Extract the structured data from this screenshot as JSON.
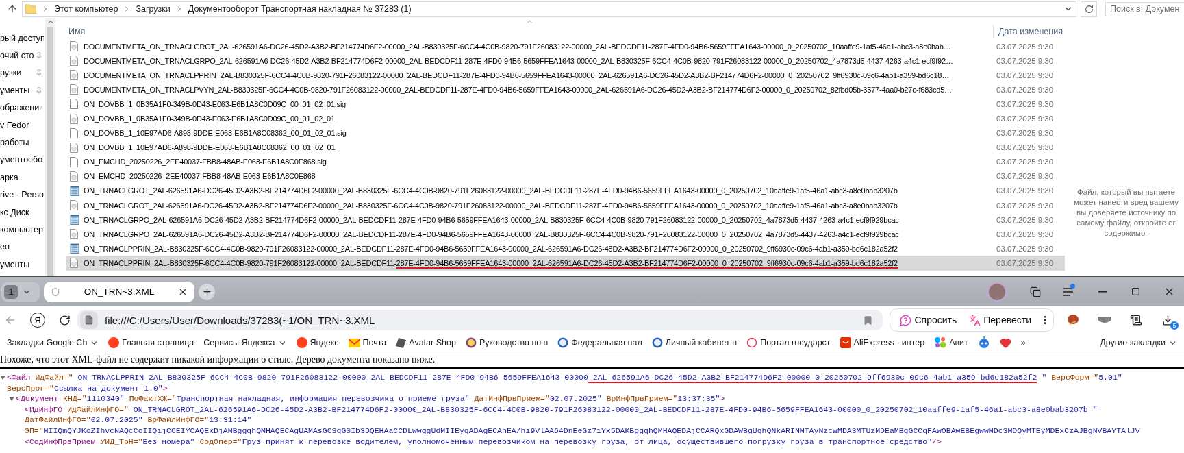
{
  "explorer": {
    "breadcrumbs": [
      "Этот компьютер",
      "Загрузки",
      "Документооборот Транспортная накладная № 37283 (1)"
    ],
    "search": {
      "placeholder": "Поиск в: Докумен"
    },
    "nav_items": [
      {
        "label": "рый доступ",
        "pinned": false
      },
      {
        "label": "очий сто",
        "pinned": true
      },
      {
        "label": "рузки",
        "pinned": true
      },
      {
        "label": "ументы",
        "pinned": true
      },
      {
        "label": "ображени",
        "pinned": true
      },
      {
        "label": "v Fedor",
        "pinned": false
      },
      {
        "label": "работы",
        "pinned": false
      },
      {
        "label": "ументообо",
        "pinned": false
      },
      {
        "label": "арка",
        "pinned": false
      },
      {
        "label": "rive - Perso",
        "pinned": false
      },
      {
        "label": "кс Диск",
        "pinned": false
      },
      {
        "label": "компьютер",
        "pinned": false
      },
      {
        "label": "ео",
        "pinned": false
      },
      {
        "label": "ументы",
        "pinned": false
      }
    ],
    "columns": [
      "Имя",
      "Дата изменения"
    ],
    "files": [
      {
        "kind": "meta",
        "name": [
          {
            "text": "DOCUMENTMETA_ON_TRNACLGROT_2AL-626591A6-DC26-45D2-A3B2-BF214774D6F2-00000_2AL-B830325F-6CC4-4C0B-9820-791F26083122-00000_2AL-BEDCDF11-287E-4FD0-94B6-5659FFEA1643-00000_0_20250702_10aaffe9-1af5-46a1-abc3-a8e0bab…",
            "marked": false
          }
        ],
        "date": "03.07.2025 9:30",
        "selected": false
      },
      {
        "kind": "meta",
        "name": [
          {
            "text": "DOCUMENTMETA_ON_TRNACLGRPO_2AL-626591A6-DC26-45D2-A3B2-BF214774D6F2-00000_2AL-BEDCDF11-287E-4FD0-94B6-5659FFEA1643-00000_2AL-B830325F-6CC4-4C0B-9820-791F26083122-00000_0_20250702_4a7873d5-4437-4263-a4c1-ecf9f92…",
            "marked": false
          }
        ],
        "date": "03.07.2025 9:30",
        "selected": false
      },
      {
        "kind": "meta",
        "name": [
          {
            "text": "DOCUMENTMETA_ON_TRNACLPPRIN_2AL-B830325F-6CC4-4C0B-9820-791F26083122-00000_2AL-BEDCDF11-287E-4FD0-94B6-5659FFEA1643-00000_2AL-626591A6-DC26-45D2-A3B2-BF214774D6F2-00000_0_20250702_9ff6930c-09c6-4ab1-a359-bd6c18…",
            "marked": false
          }
        ],
        "date": "03.07.2025 9:30",
        "selected": false
      },
      {
        "kind": "meta",
        "name": [
          {
            "text": "DOCUMENTMETA_ON_TRNACLPVYN_2AL-B830325F-6CC4-4C0B-9820-791F26083122-00000_2AL-BEDCDF11-287E-4FD0-94B6-5659FFEA1643-00000_2AL-626591A6-DC26-45D2-A3B2-BF214774D6F2-00000_0_20250702_82fbd05b-3577-4aa0-b27e-f683cd5…",
            "marked": false
          }
        ],
        "date": "03.07.2025 9:30",
        "selected": false
      },
      {
        "kind": "sig",
        "name": [
          {
            "text": "ON_DOVBB_1_0B35A1F0-349B-0D43-E063-E6B1A8C0D09C_00_01_02_01.sig",
            "marked": false
          }
        ],
        "date": "03.07.2025 9:30",
        "selected": false
      },
      {
        "kind": "meta",
        "name": [
          {
            "text": "ON_DOVBB_1_0B35A1F0-349B-0D43-E063-E6B1A8C0D09C_00_01_02_01",
            "marked": false
          }
        ],
        "date": "03.07.2025 9:30",
        "selected": false
      },
      {
        "kind": "sig",
        "name": [
          {
            "text": "ON_DOVBB_1_10E97AD6-A898-9DDE-E063-E6B1A8C08362_00_01_02_01.sig",
            "marked": false
          }
        ],
        "date": "03.07.2025 9:30",
        "selected": false
      },
      {
        "kind": "meta",
        "name": [
          {
            "text": "ON_DOVBB_1_10E97AD6-A898-9DDE-E063-E6B1A8C08362_00_01_02_01",
            "marked": false
          }
        ],
        "date": "03.07.2025 9:30",
        "selected": false
      },
      {
        "kind": "sig",
        "name": [
          {
            "text": "ON_EMCHD_20250226_2EE40037-FBB8-48AB-E063-E6B1A8C0E868.sig",
            "marked": false
          }
        ],
        "date": "03.07.2025 9:30",
        "selected": false
      },
      {
        "kind": "meta",
        "name": [
          {
            "text": "ON_EMCHD_20250226_2EE40037-FBB8-48AB-E063-E6B1A8C0E868",
            "marked": false
          }
        ],
        "date": "03.07.2025 9:30",
        "selected": false
      },
      {
        "kind": "xml",
        "name": [
          {
            "text": "ON_TRNACLGROT_2AL-626591A6-DC26-45D2-A3B2-BF214774D6F2-00000_2AL-B830325F-6CC4-4C0B-9820-791F26083122-00000_2AL-BEDCDF11-287E-4FD0-94B6-5659FFEA1643-00000_0_20250702_10aaffe9-1af5-46a1-abc3-a8e0bab3207b",
            "marked": false
          }
        ],
        "date": "03.07.2025 9:30",
        "selected": false
      },
      {
        "kind": "meta",
        "name": [
          {
            "text": "ON_TRNACLGROT_2AL-626591A6-DC26-45D2-A3B2-BF214774D6F2-00000_2AL-B830325F-6CC4-4C0B-9820-791F26083122-00000_2AL-BEDCDF11-287E-4FD0-94B6-5659FFEA1643-00000_0_20250702_10aaffe9-1af5-46a1-abc3-a8e0bab3207b",
            "marked": false
          }
        ],
        "date": "03.07.2025 9:30",
        "selected": false
      },
      {
        "kind": "xml",
        "name": [
          {
            "text": "ON_TRNACLGRPO_2AL-626591A6-DC26-45D2-A3B2-BF214774D6F2-00000_2AL-BEDCDF11-287E-4FD0-94B6-5659FFEA1643-00000_2AL-B830325F-6CC4-4C0B-9820-791F26083122-00000_0_20250702_4a7873d5-4437-4263-a4c1-ecf9f929bcac",
            "marked": false
          }
        ],
        "date": "03.07.2025 9:30",
        "selected": false
      },
      {
        "kind": "meta",
        "name": [
          {
            "text": "ON_TRNACLGRPO_2AL-626591A6-DC26-45D2-A3B2-BF214774D6F2-00000_2AL-BEDCDF11-287E-4FD0-94B6-5659FFEA1643-00000_2AL-B830325F-6CC4-4C0B-9820-791F26083122-00000_0_20250702_4a7873d5-4437-4263-a4c1-ecf9f929bcac",
            "marked": false
          }
        ],
        "date": "03.07.2025 9:30",
        "selected": false
      },
      {
        "kind": "xml",
        "name": [
          {
            "text": "ON_TRNACLPPRIN_2AL-B830325F-6CC4-4C0B-9820-791F26083122-00000_2AL-BEDCDF11-287E-4FD0-94B6-5659FFEA1643-00000_2AL-626591A6-DC26-45D2-A3B2-BF214774D6F2-00000_0_20250702_9ff6930c-09c6-4ab1-a359-bd6c182a52f2",
            "marked": false
          }
        ],
        "date": "03.07.2025 9:30",
        "selected": false
      },
      {
        "kind": "meta",
        "name": [
          {
            "text": "ON_TRNACLPPRIN_2AL-B830325F-6CC4-4C0B-9820-791F26083122-00000_2AL-BEDCDF11-",
            "marked": false
          },
          {
            "text": "287E-4FD0-94B6-5659FFEA1643-00000_2AL-626591A6-DC26-45D2-A3B2-BF214774D6F2-00000_0_20250702_9ff6930c-09c6-4ab1-a359-bd6c182a52f2",
            "marked": true
          }
        ],
        "date": "03.07.2025 9:30",
        "selected": true
      }
    ],
    "preview_message": [
      "Файл, который вы пытаете",
      "может нанести вред вашему",
      "вы доверяете источнику по",
      "самому файлу, откройте ег",
      "содержимог"
    ]
  },
  "browser": {
    "tab_count": "1",
    "tabs": [
      {
        "title": "ON_TRN~3.XML",
        "selected": true
      }
    ],
    "menu_badge": true,
    "home_button": "Я",
    "url": "file:///C:/Users/User/Downloads/37283(~1/ON_TRN~3.XML",
    "assistant_buttons": [
      {
        "label": "Спросить",
        "kind": "ask"
      },
      {
        "label": "Перевести",
        "kind": "translate"
      }
    ],
    "downloads_badge": "5",
    "bookmarks": [
      {
        "label": "Закладки Google Ch",
        "kind": "folder"
      },
      {
        "label": "Главная страница",
        "kind": "yandex"
      },
      {
        "label": "Сервисы Яндекса",
        "kind": "folder"
      },
      {
        "label": "Яндекс",
        "kind": "yandex"
      },
      {
        "label": "Почта",
        "kind": "mail"
      },
      {
        "label": "Avatar Shop",
        "kind": "cube"
      },
      {
        "label": "Руководство по п",
        "kind": "sun"
      },
      {
        "label": "Федеральная нал",
        "kind": "emblem"
      },
      {
        "label": "Личный кабинет н",
        "kind": "emblem"
      },
      {
        "label": "Портал государст",
        "kind": "portal"
      },
      {
        "label": "AliExpress - интер",
        "kind": "shop"
      },
      {
        "label": "Авит",
        "kind": "dots"
      },
      {
        "kind": "robot"
      },
      {
        "kind": "heart"
      }
    ],
    "bookmarks_overflow": "»",
    "other_bookmarks": "Другие закладки",
    "xml_notice": "Похоже, что этот XML-файл не содержит никакой информации о стиле. Дерево документа показано ниже.",
    "xml_tree": [
      {
        "open": "<Файл",
        "expanded": true,
        "attributes": [
          {
            "name": "ИдФайл=\"",
            "value": [
              {
                "text": " ON_TRNACLPPRIN_2AL-B830325F-6CC4-4C0B-9820-791F26083122-00000_2AL-BEDCDF11-287E-4FD0-94B6-5659FFEA1643-00000",
                "marked": false
              },
              {
                "text": "_2AL-626591A6-DC26-45D2-A3B2-BF214774D6F2-00000_0_20250702_9ff6930c-09c6-4ab1-a359-bd6c182a52f2",
                "marked": true
              },
              {
                "text": " \"",
                "marked": false
              }
            ]
          },
          {
            "name": "ВерсФорм=\"",
            "value": [
              {
                "text": "5.01\"",
                "marked": false
              }
            ]
          },
          {
            "name": "ВерсПрог=\"",
            "value": [
              {
                "text": "Ссылка на документ 1.0\"",
                "marked": false
              }
            ]
          }
        ],
        "close": ">",
        "children": [
          {
            "open": "<Документ",
            "expanded": true,
            "attributes": [
              {
                "name": "КНД=\"",
                "value": [
                  {
                    "text": "1110340\"",
                    "marked": false
                  }
                ]
              },
              {
                "name": "ПоФактХЖ=\"",
                "value": [
                  {
                    "text": "Транспортная накладная, информация перевозчика о приеме груза\"",
                    "marked": false
                  }
                ]
              },
              {
                "name": "ДатИнфПрвПрием=\"",
                "value": [
                  {
                    "text": "02.07.2025\"",
                    "marked": false
                  }
                ]
              },
              {
                "name": "ВрИнфПрвПрием=\"",
                "value": [
                  {
                    "text": "13:37:35\"",
                    "marked": false
                  }
                ]
              }
            ],
            "close": ">",
            "children": [
              {
                "open": "<ИдИнфГО",
                "attributes": [
                  {
                    "name": "ИдФайлИнфГО=\"",
                    "value": [
                      {
                        "text": " ON_TRNACLGROT_2AL-626591A6-DC26-45D2-A3B2-BF214774D6F2-00000_2AL-B830325F-6CC4-4C0B-9820-791F26083122-00000_2AL-BEDCDF11-287E-4FD0-94B6-5659FFEA1643-00000_0_20250702_10aaffe9-1af5-46a1-abc3-a8e0bab3207b \"",
                        "marked": false
                      }
                    ]
                  },
                  {
                    "name": "ДатФайлИнфГО=\"",
                    "value": [
                      {
                        "text": "02.07.2025\"",
                        "marked": false
                      }
                    ]
                  },
                  {
                    "name": "ВрФайлИнфГО=\"",
                    "value": [
                      {
                        "text": "13:31:14\"",
                        "marked": false
                      }
                    ]
                  },
                  {
                    "name": "ЭП=\"",
                    "value": [
                      {
                        "text": "MIIQmQYJKoZIhvcNAQcCoIIQijCCEIYCAQExDjAMBggqhQMHAQECAgUAMAsGCSqGSIb3DQEHAaCCDLwwggUdMIIEyqADAgECAhEA/hi9VlAA64DnEeGz7iYx5DAKBggqhQMHAQEDAjCCARQxGDAWBgUqhQNkARINMTAyNzcwMDA3MTUzMDEaMBgGCCqFAwOBAwEBEgwwMDc3MDQyMTEyMDExCzAJBgNVBAYTAlJV",
                        "marked": false
                      }
                    ]
                  }
                ]
              },
              {
                "open": "<СодИнфПрвПрием",
                "attributes": [
                  {
                    "name": "УИД_ТрН=\"",
                    "value": [
                      {
                        "text": "Без номера\"",
                        "marked": false
                      }
                    ]
                  },
                  {
                    "name": "СодОпер=\"",
                    "value": [
                      {
                        "text": "Груз принят к перевозке водителем, уполномоченным перевозчиком на перевозку груза, от лица, осуществившего погрузку груза в транспортное средство\"",
                        "marked": false
                      }
                    ]
                  }
                ],
                "close": "/>"
              }
            ]
          }
        ]
      }
    ]
  }
}
